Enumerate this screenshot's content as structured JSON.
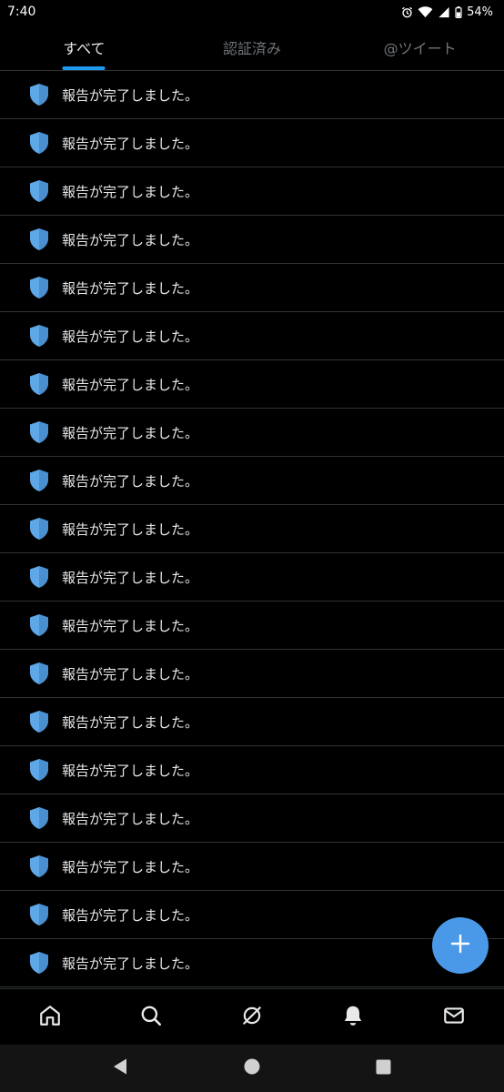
{
  "status_bar": {
    "time": "7:40",
    "battery": "54%",
    "icons": [
      "alarm-icon",
      "wifi-icon",
      "signal-icon",
      "battery-icon"
    ]
  },
  "tabs": [
    {
      "label": "すべて",
      "active": true
    },
    {
      "label": "認証済み",
      "active": false
    },
    {
      "label": "@ツイート",
      "active": false
    }
  ],
  "notifications": {
    "icon": "shield-icon",
    "items": [
      "報告が完了しました。",
      "報告が完了しました。",
      "報告が完了しました。",
      "報告が完了しました。",
      "報告が完了しました。",
      "報告が完了しました。",
      "報告が完了しました。",
      "報告が完了しました。",
      "報告が完了しました。",
      "報告が完了しました。",
      "報告が完了しました。",
      "報告が完了しました。",
      "報告が完了しました。",
      "報告が完了しました。",
      "報告が完了しました。",
      "報告が完了しました。",
      "報告が完了しました。",
      "報告が完了しました。",
      "報告が完了しました。"
    ]
  },
  "fab": {
    "icon": "plus-icon"
  },
  "bottom_nav": [
    "home-icon",
    "search-icon",
    "spaces-icon",
    "notifications-icon",
    "messages-icon"
  ],
  "system_nav": [
    "back-icon",
    "home-circle-icon",
    "recents-icon"
  ],
  "colors": {
    "accent": "#1d9bf0",
    "fab": "#4a99e9",
    "shield": "#5fa8e8",
    "divider": "#2f3336"
  }
}
